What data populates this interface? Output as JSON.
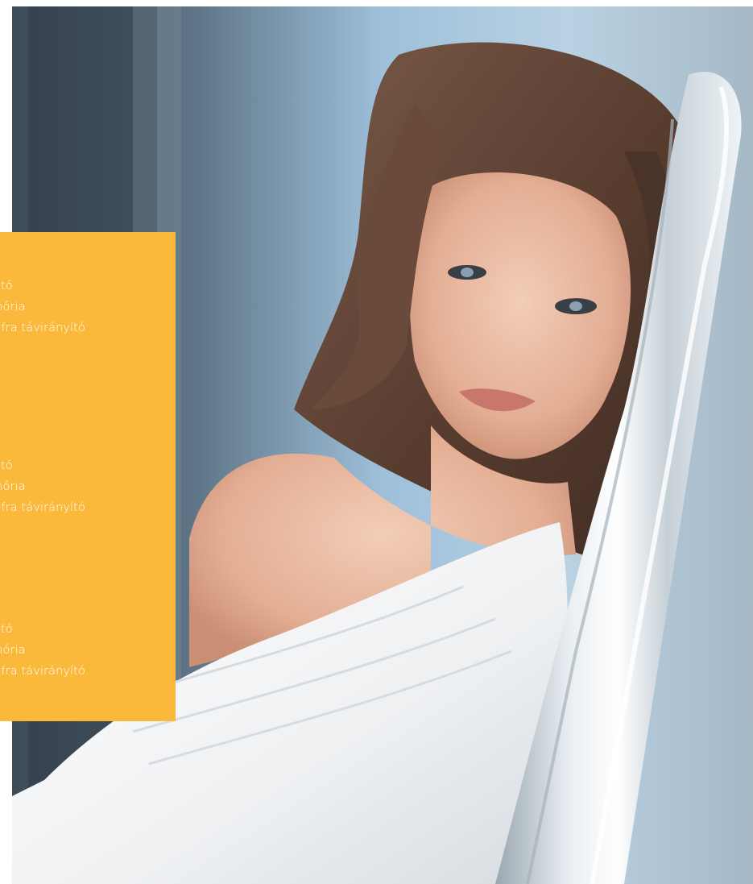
{
  "hero_image": {
    "icon": "portrait-photo-icon"
  },
  "feature_panel": {
    "accent_color": "#fbb93b",
    "groups": [
      {
        "lines": [
          "ozható",
          "memória",
          "s / infra távirányító"
        ]
      },
      {
        "lines": [
          "ozható",
          "memória",
          "s / infra távirányító"
        ]
      },
      {
        "lines": [
          "ozható",
          "memória",
          "s / infra távirányító"
        ]
      }
    ]
  }
}
